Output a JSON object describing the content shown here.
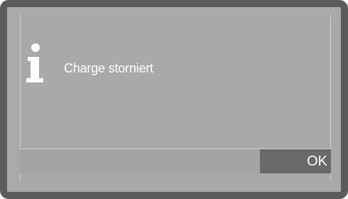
{
  "dialog": {
    "icon": "info-icon",
    "message": "Charge storniert",
    "ok_label": "OK"
  },
  "colors": {
    "bezel": "#5b5b5b",
    "screen": "#a9a9a9",
    "button": "#6a6a6a",
    "text": "#ffffff"
  }
}
